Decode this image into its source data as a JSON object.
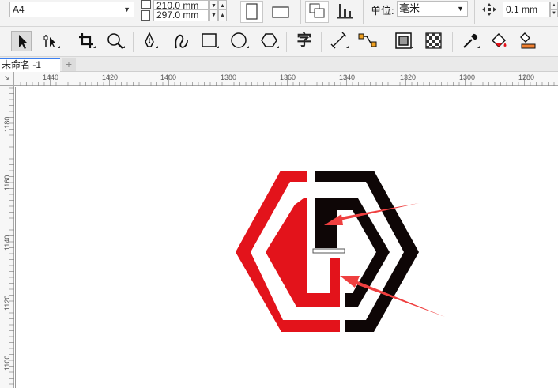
{
  "property_bar": {
    "paper_size": "A4",
    "width_value": "210.0 mm",
    "height_value": "297.0 mm",
    "unit_label": "单位:",
    "unit_value": "毫米",
    "nudge_value": "0.1 mm"
  },
  "toolbox": {
    "tools": [
      "pick-tool",
      "shape-tool",
      "crop-tool",
      "zoom-tool",
      "freehand-tool",
      "artistic-media-tool",
      "rectangle-tool",
      "ellipse-tool",
      "polygon-tool",
      "text-tool",
      "parallel-dimension-tool",
      "connector-tool",
      "drop-shadow-tool",
      "transparency-tool",
      "eyedropper-tool",
      "interactive-fill-tool",
      "smart-fill-tool"
    ],
    "text_tool_label": "字"
  },
  "document_tab": {
    "title": "未命名 -1",
    "add_label": "+"
  },
  "rulers": {
    "corner_label": "↘",
    "horizontal_labels": [
      "1440",
      "1420",
      "1400",
      "1380",
      "1360",
      "1340",
      "1320",
      "1300",
      "1280"
    ],
    "vertical_labels": [
      "180",
      "160",
      "140",
      "120",
      "100"
    ]
  },
  "colors": {
    "red": "#e3131b",
    "black": "#0e0606",
    "arrow": "#ef3f3f"
  }
}
